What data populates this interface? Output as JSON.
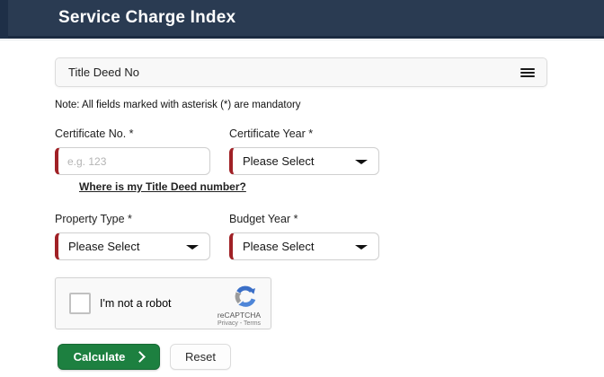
{
  "header": {
    "title": "Service Charge Index"
  },
  "title_deed_bar": {
    "label": "Title Deed No",
    "icon": "menu-icon"
  },
  "note": "Note: All fields marked with asterisk (*) are mandatory",
  "form": {
    "certificate_no": {
      "label": "Certificate No. *",
      "placeholder": "e.g. 123",
      "value": ""
    },
    "certificate_year": {
      "label": "Certificate Year *",
      "selected": "Please Select"
    },
    "help_link": "Where is my Title Deed number?",
    "property_type": {
      "label": "Property Type *",
      "selected": "Please Select"
    },
    "budget_year": {
      "label": "Budget Year *",
      "selected": "Please Select"
    }
  },
  "captcha": {
    "checkbox_label": "I'm not a robot",
    "brand": "reCAPTCHA",
    "terms": "Privacy - Terms"
  },
  "actions": {
    "calculate": "Calculate",
    "reset": "Reset"
  },
  "colors": {
    "header_bg": "#2a3b52",
    "accent_red": "#a02126",
    "button_green": "#1d8040",
    "recaptcha_blue": "#3b6fc7"
  }
}
